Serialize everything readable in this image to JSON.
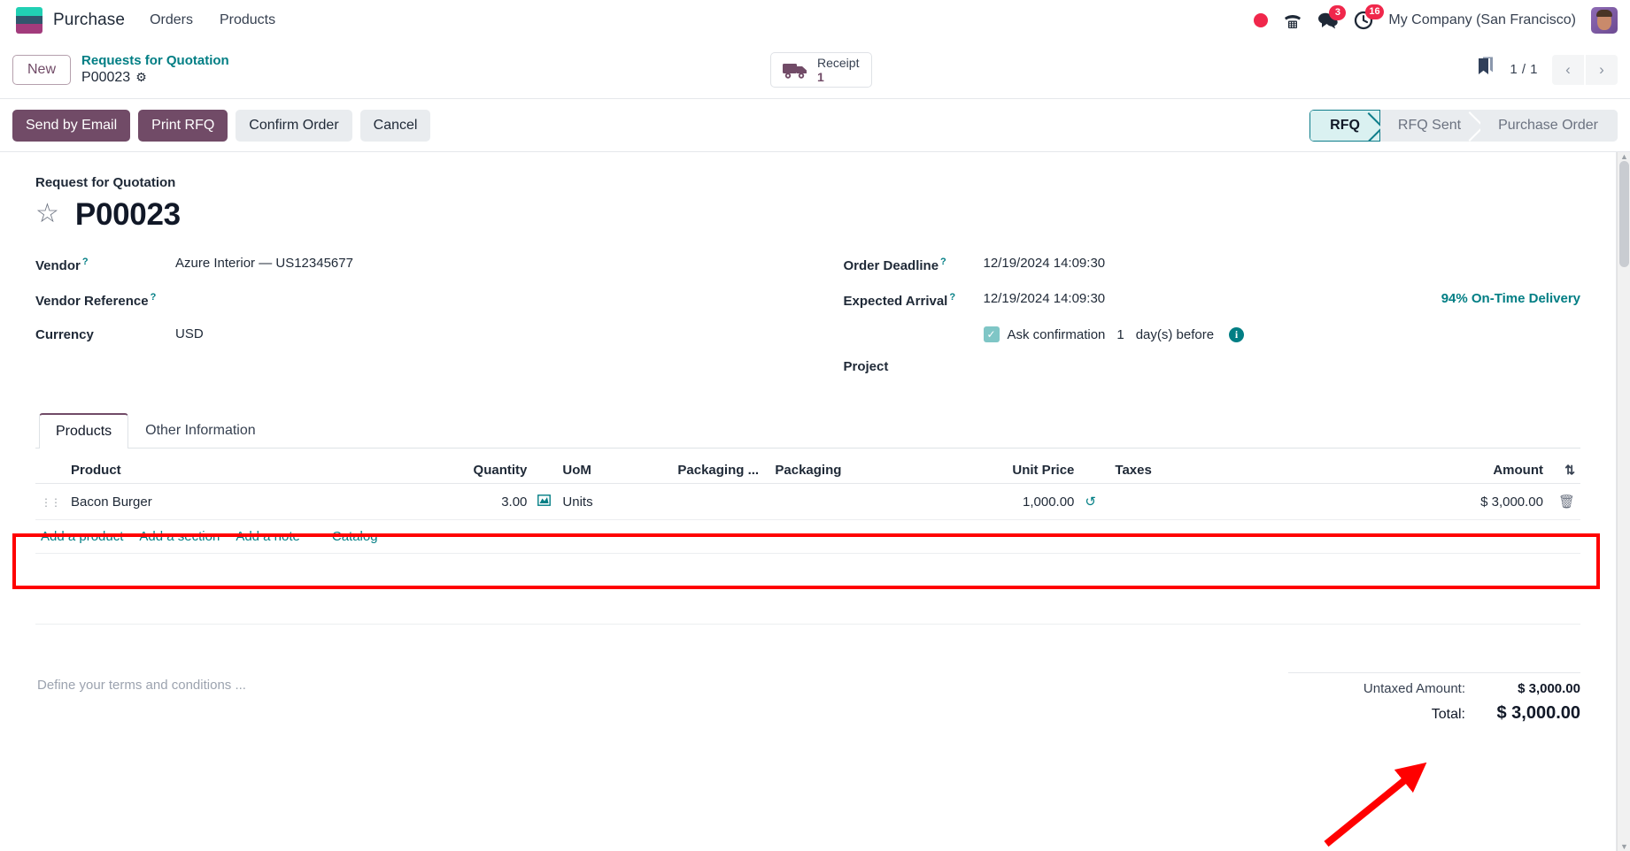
{
  "navbar": {
    "app_name": "Purchase",
    "menu": [
      {
        "label": "Orders",
        "name": "nav-orders"
      },
      {
        "label": "Products",
        "name": "nav-products"
      }
    ],
    "messages_badge": "3",
    "activities_badge": "16",
    "company": "My Company (San Francisco)"
  },
  "control_panel": {
    "new_label": "New",
    "breadcrumb_parent": "Requests for Quotation",
    "breadcrumb_current": "P00023",
    "smart_button": {
      "label": "Receipt",
      "count": "1"
    },
    "pager": "1 / 1"
  },
  "actions": {
    "send_by_email": "Send by Email",
    "print_rfq": "Print RFQ",
    "confirm_order": "Confirm Order",
    "cancel": "Cancel"
  },
  "statusbar": {
    "stages": [
      {
        "label": "RFQ",
        "active": true
      },
      {
        "label": "RFQ Sent",
        "active": false
      },
      {
        "label": "Purchase Order",
        "active": false
      }
    ]
  },
  "form": {
    "subtitle": "Request for Quotation",
    "record_name": "P00023",
    "left_fields": [
      {
        "label": "Vendor",
        "help": "?",
        "value": "Azure Interior — US12345677"
      },
      {
        "label": "Vendor Reference",
        "help": "?",
        "value": ""
      },
      {
        "label": "Currency",
        "help": "",
        "value": "USD"
      }
    ],
    "right_fields": [
      {
        "label": "Order Deadline",
        "help": "?",
        "value": "12/19/2024 14:09:30"
      },
      {
        "label": "Expected Arrival",
        "help": "?",
        "value": "12/19/2024 14:09:30"
      },
      {
        "label": "Project",
        "help": "",
        "value": ""
      }
    ],
    "on_time_delivery": "94% On-Time Delivery",
    "ask_confirmation_label": "Ask confirmation",
    "ask_confirmation_days": "1",
    "days_before_label": "day(s) before",
    "ask_confirmation_checked": true
  },
  "notebook": {
    "tabs": [
      {
        "label": "Products",
        "active": true
      },
      {
        "label": "Other Information",
        "active": false
      }
    ]
  },
  "lines_table": {
    "headers": [
      "Product",
      "Quantity",
      "UoM",
      "Packaging ...",
      "Packaging",
      "Unit Price",
      "Taxes",
      "Amount"
    ],
    "rows": [
      {
        "product": "Bacon Burger",
        "quantity": "3.00",
        "uom": "Units",
        "packaging_qty": "",
        "packaging": "",
        "unit_price": "1,000.00",
        "taxes": "",
        "amount": "$ 3,000.00"
      }
    ],
    "add_links": [
      "Add a product",
      "Add a section",
      "Add a note",
      "Catalog"
    ]
  },
  "footer": {
    "terms_placeholder": "Define your terms and conditions ...",
    "totals": [
      {
        "label": "Untaxed Amount:",
        "value": "$ 3,000.00",
        "grand": false
      },
      {
        "label": "Total:",
        "value": "$ 3,000.00",
        "grand": true
      }
    ]
  },
  "colors": {
    "brand_purple": "#714b67",
    "teal": "#017e84",
    "annotation_red": "#ff0000",
    "badge_red": "#f0274b"
  }
}
